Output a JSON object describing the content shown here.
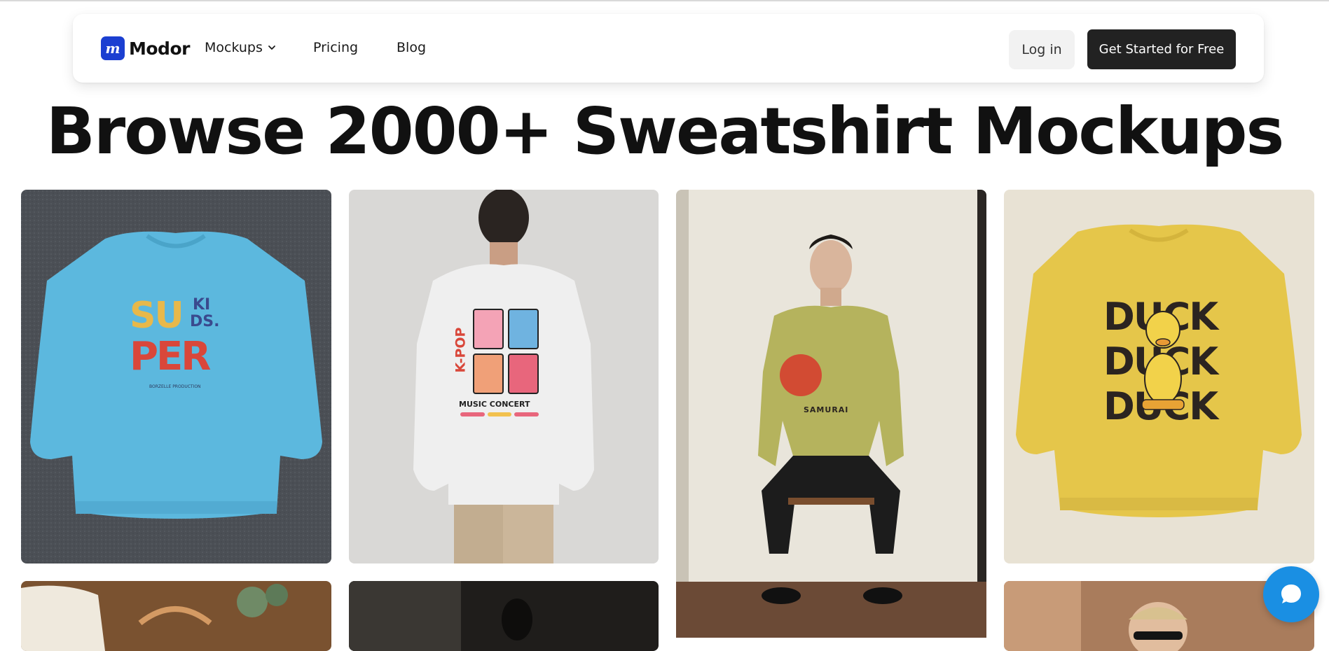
{
  "nav": {
    "brand": "Modor",
    "logo_letter": "m",
    "links": [
      {
        "label": "Mockups",
        "has_dropdown": true
      },
      {
        "label": "Pricing"
      },
      {
        "label": "Blog"
      }
    ],
    "login_label": "Log in",
    "cta_label": "Get Started for Free"
  },
  "hero": {
    "title": "Browse 2000+ Sweatshirt Mockups"
  },
  "mockups": [
    {
      "name": "Blue sweatshirt flat lay on asphalt",
      "print": [
        "SU",
        "KI",
        "DS.",
        "PER"
      ],
      "small_text": "BORZELLE PRODUCTION",
      "color": "#5cb8de"
    },
    {
      "name": "White sweatshirt back view",
      "print_title": "K-POP",
      "print_caption": "MUSIC CONCERT",
      "color": "#ececec"
    },
    {
      "name": "Man seated in olive sweatshirt",
      "print_caption": "SAMURAI",
      "color": "#b5b35d"
    },
    {
      "name": "Yellow sweatshirt flat lay",
      "print": [
        "DUCK",
        "DUCK",
        "DUCK"
      ],
      "color": "#e5c64a"
    }
  ],
  "colors": {
    "brand": "#1b3fd1",
    "cta": "#222222",
    "chat": "#1a8fe3"
  },
  "icons": [
    "chevron-down-icon",
    "chat-icon"
  ]
}
